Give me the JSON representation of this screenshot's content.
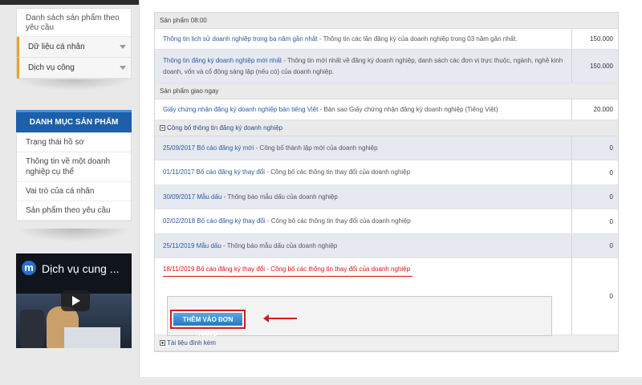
{
  "sidebar": {
    "request_link": "Danh sách sản phẩm theo yêu cầu",
    "items": [
      {
        "label": "Dữ liệu cá nhân"
      },
      {
        "label": "Dịch vụ công"
      }
    ]
  },
  "catalog": {
    "title": "DANH MỤC SẢN PHẨM",
    "items": [
      {
        "label": "Trạng thái hồ sơ"
      },
      {
        "label": "Thông tin về một doanh nghiệp cụ thể"
      },
      {
        "label": "Vai trò của cá nhân"
      },
      {
        "label": "Sản phẩm theo yêu cầu"
      }
    ]
  },
  "video": {
    "logo": "m",
    "title": "Dịch vụ cung ..."
  },
  "groups": {
    "products_0800": "Sản phẩm 08:00",
    "products_immediate": "Sản phẩm giao ngay",
    "publication": "Công bố thông tin đăng ký doanh nghiệp",
    "attachments": "Tài liệu đính kèm"
  },
  "products_0800": [
    {
      "name": "Thông tin lịch sử doanh nghiệp trong ba năm gần nhất",
      "desc": " - Thông tin các lần đăng ký của doanh nghiệp trong 03 năm gần nhất.",
      "price": "150.000"
    },
    {
      "name": "Thông tin đăng ký doanh nghiệp mới nhất",
      "desc": " - Thông tin mới nhất về đăng ký doanh nghiệp, danh sách các đơn vị trực thuộc, ngành, nghề kinh doanh, vốn và cổ đông sáng lập (nếu có) của doanh nghiệp.",
      "price": "150.000"
    }
  ],
  "products_immediate": [
    {
      "name": "Giấy chứng nhận đăng ký doanh nghiệp bản tiếng Việt",
      "desc": " - Bản sao Giấy chứng nhận đăng ký doanh nghiệp (Tiếng Việt)",
      "price": "20.000"
    }
  ],
  "publications": [
    {
      "name": "25/09/2017 Bố cáo đăng ký mới",
      "desc": " - Công bố thành lập mới của doanh nghiệp",
      "price": "0"
    },
    {
      "name": "01/11/2017 Bố cáo đăng ký thay đổi",
      "desc": " - Công bố các thông tin thay đổi của doanh nghiệp",
      "price": "0"
    },
    {
      "name": "30/09/2017 Mẫu dấu",
      "desc": " - Thông báo mẫu dấu của doanh nghiệp",
      "price": "0"
    },
    {
      "name": "02/02/2018 Bố cáo đăng ký thay đổi",
      "desc": " - Công bố các thông tin thay đổi của doanh nghiệp",
      "price": "0"
    },
    {
      "name": "25/11/2019 Mẫu dấu",
      "desc": " - Thông báo mẫu dấu của doanh nghiệp",
      "price": "0"
    },
    {
      "name": "18/11/2019 Bố cáo đăng ký thay đổi",
      "desc": " - Công bố các thông tin thay đổi của doanh nghiệp",
      "price": "0"
    }
  ],
  "order_button": "THÊM VÀO ĐƠN HÀNG",
  "colors": {
    "accent": "#1d5fa9",
    "highlight": "#d11111",
    "tab_marker": "#f0a022"
  }
}
